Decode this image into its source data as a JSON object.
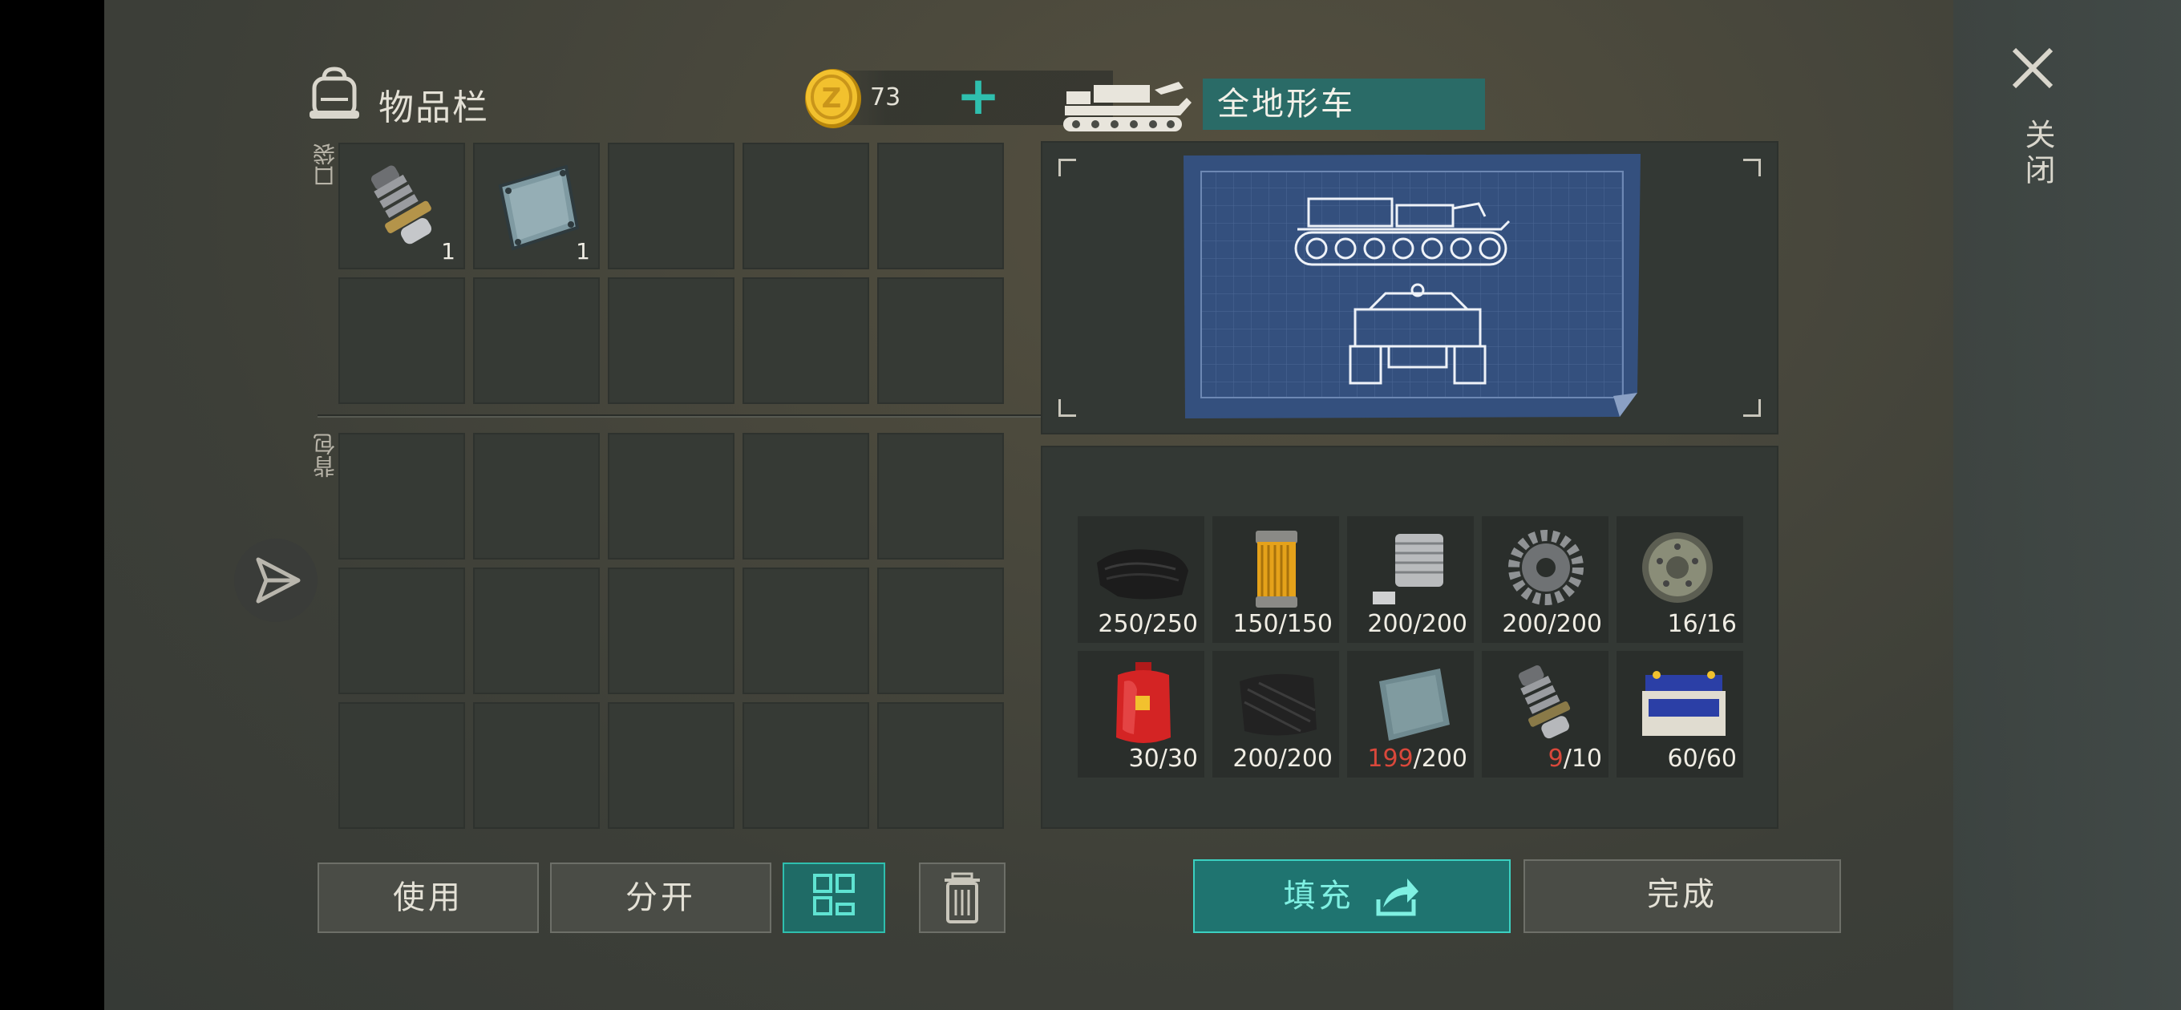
{
  "inventory": {
    "title": "物品栏",
    "coins": "73",
    "pocket_label": "口袋",
    "backpack_label": "背包",
    "pocket_slots": [
      {
        "item": "spring-part-icon",
        "qty": "1"
      },
      {
        "item": "metal-plate-icon",
        "qty": "1"
      },
      {
        "item": "",
        "qty": ""
      },
      {
        "item": "",
        "qty": ""
      },
      {
        "item": "",
        "qty": ""
      },
      {
        "item": "",
        "qty": ""
      },
      {
        "item": "",
        "qty": ""
      },
      {
        "item": "",
        "qty": ""
      },
      {
        "item": "",
        "qty": ""
      },
      {
        "item": "",
        "qty": ""
      }
    ]
  },
  "buttons": {
    "use": "使用",
    "split": "分开",
    "fill": "填充",
    "done": "完成"
  },
  "vehicle": {
    "name": "全地形车"
  },
  "materials": [
    {
      "icon": "leather-icon",
      "have": "250",
      "need": "250",
      "low": false
    },
    {
      "icon": "oil-filter-icon",
      "have": "150",
      "need": "150",
      "low": false
    },
    {
      "icon": "engine-block-icon",
      "have": "200",
      "need": "200",
      "low": false
    },
    {
      "icon": "gear-icon",
      "have": "200",
      "need": "200",
      "low": false
    },
    {
      "icon": "tank-wheel-icon",
      "have": "16",
      "need": "16",
      "low": false
    },
    {
      "icon": "gas-cylinder-icon",
      "have": "30",
      "need": "30",
      "low": false
    },
    {
      "icon": "rubber-sheet-icon",
      "have": "200",
      "need": "200",
      "low": false
    },
    {
      "icon": "metal-plate-icon",
      "have": "199",
      "need": "200",
      "low": true
    },
    {
      "icon": "spring-part-icon",
      "have": "9",
      "need": "10",
      "low": true
    },
    {
      "icon": "car-battery-icon",
      "have": "60",
      "need": "60",
      "low": false
    }
  ],
  "close_label": "关闭",
  "colors": {
    "accent": "#2fbfae",
    "low": "#d9483b"
  }
}
